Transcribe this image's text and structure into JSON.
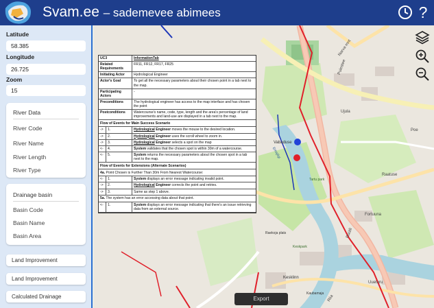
{
  "header": {
    "app_name": "Svam.ee",
    "subtitle": "– sademevee abimees",
    "help_symbol": "?"
  },
  "sidebar": {
    "latitude": {
      "label": "Latitude",
      "value": "58.385"
    },
    "longitude": {
      "label": "Longitude",
      "value": "26.725"
    },
    "zoom": {
      "label": "Zoom",
      "value": "15"
    },
    "river_card": {
      "title": "River Data",
      "items": [
        "River Code",
        "River Name",
        "River Length",
        "River Type"
      ]
    },
    "basin_card": {
      "title": "Drainage basin",
      "items": [
        "Basin Code",
        "Basin Name",
        "Basin Area"
      ]
    },
    "buttons": [
      "Land Improvement",
      "Land Improvement",
      "Calculated Drainage"
    ]
  },
  "map": {
    "export_label": "Export",
    "labels": {
      "street1": "Puiestee",
      "street2": "Narva mnt",
      "street3": "Vabaduse",
      "street4": "Kesklinn",
      "street5": "Raatuse",
      "street6": "Ujula",
      "street7": "Emajõgi",
      "street8": "Fortuuna",
      "street9": "Tartu park",
      "street10": "Raekoja plats",
      "street11": "Keskpark",
      "street12": "Uueturu",
      "street13": "Riia",
      "street14": "Kaubamaja",
      "street15": "Rüütli",
      "street16": "Poe"
    },
    "markers": {
      "blue": "#2143d8",
      "red": "#e0202a"
    }
  },
  "usecase": {
    "rows": [
      {
        "k": "UC3",
        "v": "InformationTab",
        "link": true
      },
      {
        "k": "Related Requirements",
        "v": "FR11, FR12, FR17, FR25"
      },
      {
        "k": "Initiating Actor",
        "v": "Hydrological Engineer"
      },
      {
        "k": "Actor's Goal",
        "v": "To get all the necessary parameters about their chosen point in a tab next to the map."
      },
      {
        "k": "Participating Actors",
        "v": "-"
      },
      {
        "k": "Preconditions",
        "v": "The hydrological engineer has access to the map interface and has chosen the point"
      },
      {
        "k": "Postconditions",
        "v": "Watercourse's name, code, type, length and the area's percentage of land improvements and land-use are displayed in a tab next to the map."
      }
    ],
    "main_header": "Flow of Events for Main Success Scenario",
    "main_steps": [
      {
        "a": "->",
        "n": "1.",
        "actor": "Hydrological",
        "actor2": " Engineer",
        "t": " moves the mouse to the desired location."
      },
      {
        "a": "->",
        "n": "2.",
        "actor": "Hydrological",
        "actor2": " Engineer",
        "t": " uses the scroll wheel to zoom in."
      },
      {
        "a": "->",
        "n": "3.",
        "actor": "Hydrological",
        "actor2": " Engineer",
        "t": " selects a spot on the map"
      },
      {
        "a": "<-",
        "n": "4.",
        "actor": "",
        "actor2": "System",
        "t": " validates that the chosen spot is within 30m of a watercourse."
      },
      {
        "a": "<-",
        "n": "5.",
        "actor": "",
        "actor2": "System",
        "t": " returns the necessary parameters about the chosen spot in a tab next to the map."
      }
    ],
    "ext_header": "Flow of Events for Extensions (Alternate Scenarios)",
    "ext4_title_bold": "4a.",
    "ext4_title": " Point Chosen is Further Than 30m From Nearest Watercourse:",
    "ext4_steps": [
      {
        "a": "<-",
        "n": "1.",
        "actor": "",
        "actor2": "System",
        "t": " displays an error message indicating invalid point."
      },
      {
        "a": "->",
        "n": "2.",
        "actor": "Hydrological",
        "actor2": " Engineer",
        "t": " corrects the point and retries."
      },
      {
        "a": "->",
        "n": "3.",
        "actor": "",
        "actor2": "",
        "t": "Same as step 1 above."
      }
    ],
    "ext5_title_bold": "5a.",
    "ext5_title": " The system has an error accessing data about that point.",
    "ext5_steps": [
      {
        "a": "<-",
        "n": "1.",
        "actor": "",
        "actor2": "System",
        "t": " displays an error message indicating that there's an issue retrieving data from an external source."
      }
    ]
  }
}
